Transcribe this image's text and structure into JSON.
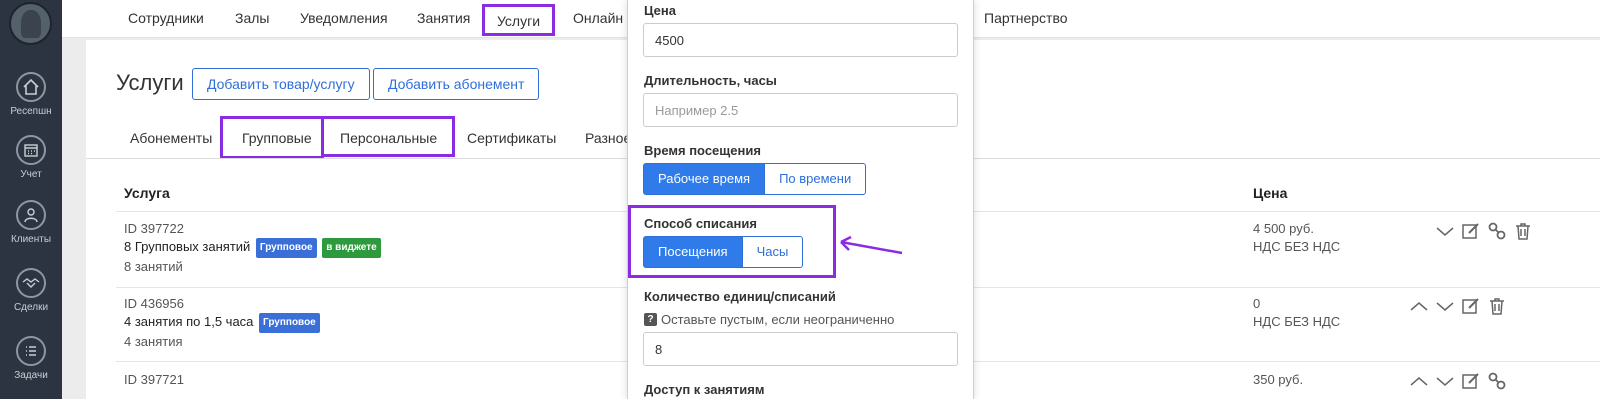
{
  "sidebar": {
    "items": [
      {
        "label": "Ресепшн",
        "icon": "home-icon"
      },
      {
        "label": "Учет",
        "icon": "calendar-icon"
      },
      {
        "label": "Клиенты",
        "icon": "user-icon"
      },
      {
        "label": "Сделки",
        "icon": "handshake-icon"
      },
      {
        "label": "Задачи",
        "icon": "tasks-icon"
      }
    ]
  },
  "topnav": {
    "items": [
      "Сотрудники",
      "Залы",
      "Уведомления",
      "Занятия",
      "Услуги",
      "Онлайн",
      "Партнерство"
    ],
    "active": "Услуги"
  },
  "page": {
    "title": "Услуги",
    "add_product_button": "Добавить товар/услугу",
    "add_subscription_button": "Добавить абонемент"
  },
  "tabs": [
    "Абонементы",
    "Групповые",
    "Персональные",
    "Сертификаты",
    "Разное"
  ],
  "table": {
    "headers": {
      "service": "Услуга",
      "price": "Цена"
    },
    "rows": [
      {
        "id": "ID 397722",
        "name": "8 Групповых занятий",
        "badges": [
          "Групповое",
          "в виджете"
        ],
        "sub": "8 занятий",
        "price": "4 500 руб.",
        "vat": "НДС БЕЗ НДС"
      },
      {
        "id": "ID 436956",
        "name": "4 занятия по 1,5 часа",
        "badges": [
          "Групповое"
        ],
        "sub": "4 занятия",
        "price": "0",
        "vat": "НДС БЕЗ НДС"
      },
      {
        "id": "ID 397721",
        "name": "",
        "badges": [],
        "sub": "",
        "price": "350 руб.",
        "vat": ""
      }
    ]
  },
  "modal": {
    "price_label": "Цена",
    "price_value": "4500",
    "duration_label": "Длительность, часы",
    "duration_placeholder": "Например 2.5",
    "visit_time_label": "Время посещения",
    "visit_time_options": [
      "Рабочее время",
      "По времени"
    ],
    "writeoff_label": "Способ списания",
    "writeoff_options": [
      "Посещения",
      "Часы"
    ],
    "units_label": "Количество единиц/списаний",
    "units_hint": "Оставьте пустым, если неограниченно",
    "units_value": "8",
    "access_label": "Доступ к занятиям"
  },
  "colors": {
    "accent": "#2f7be9",
    "highlight": "#8b2be2",
    "sidebar": "#2b3440"
  }
}
